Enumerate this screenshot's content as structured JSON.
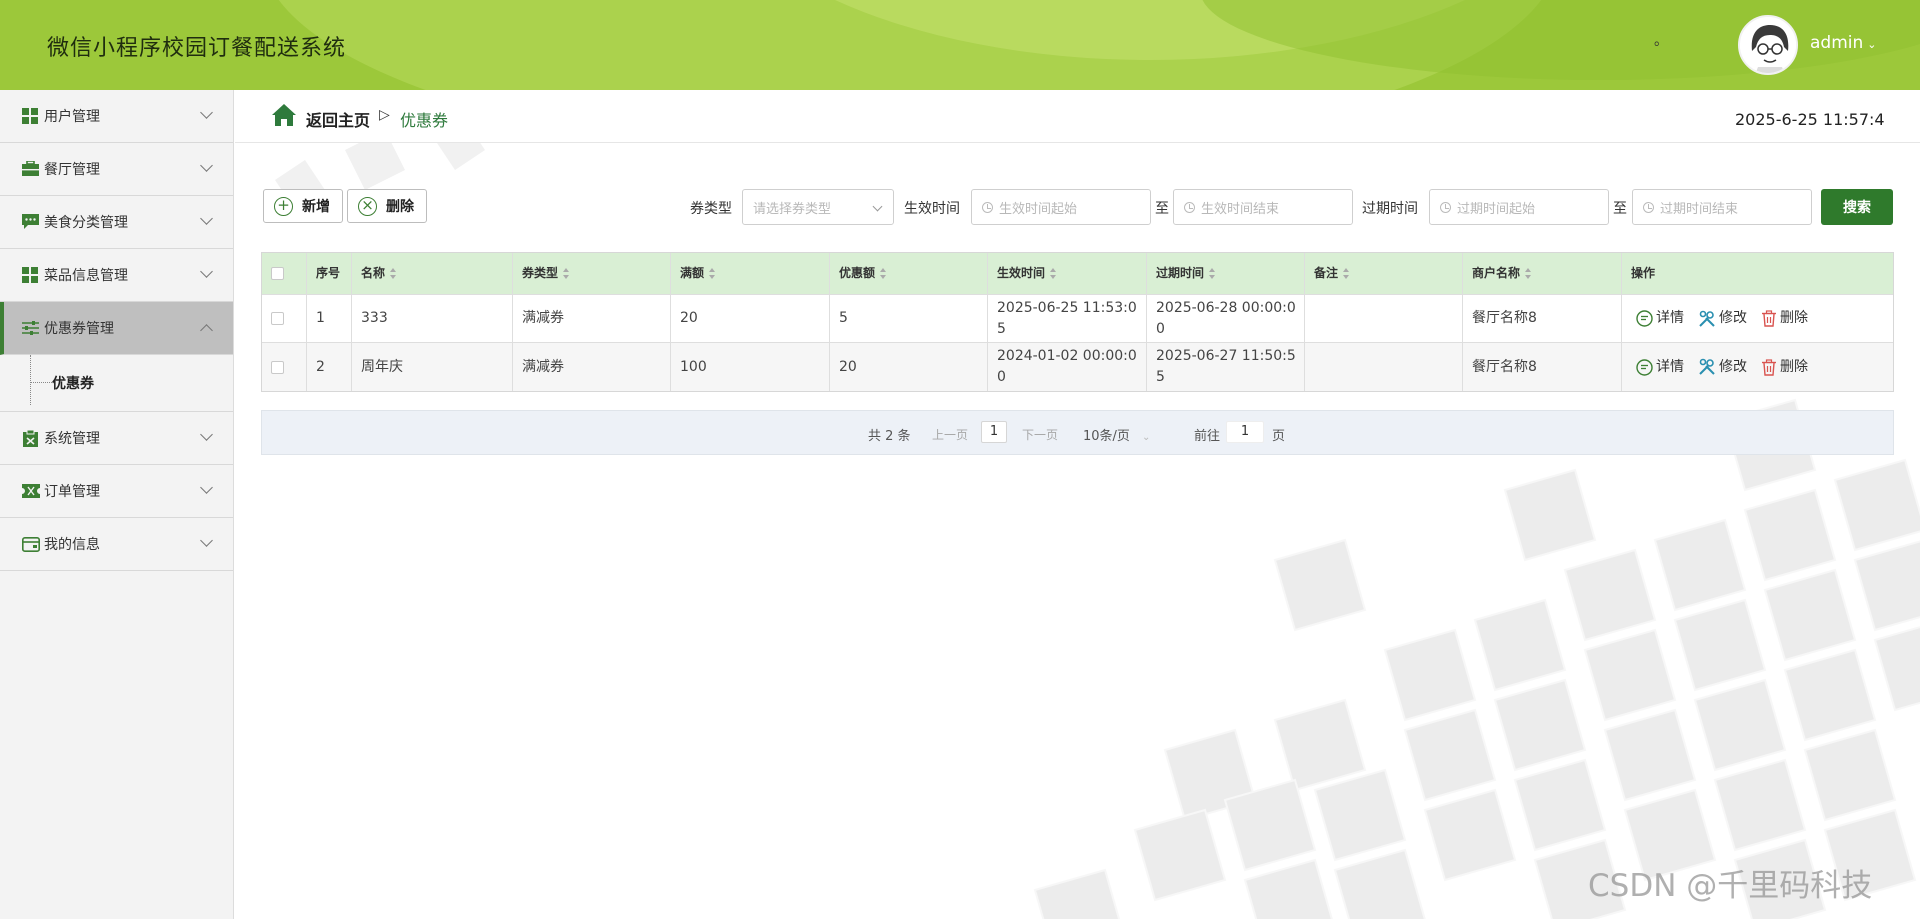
{
  "app": {
    "title": "微信小程序校园订餐配送系统",
    "dot": "。",
    "user": "admin",
    "user_chevron": "⌄"
  },
  "sidebar": {
    "items": [
      {
        "label": "用户管理",
        "icon": "grid-icon"
      },
      {
        "label": "餐厅管理",
        "icon": "briefcase-icon"
      },
      {
        "label": "美食分类管理",
        "icon": "chat-icon"
      },
      {
        "label": "菜品信息管理",
        "icon": "grid-icon"
      },
      {
        "label": "优惠券管理",
        "icon": "sliders-icon",
        "active": true
      },
      {
        "label": "系统管理",
        "icon": "clipboard-icon"
      },
      {
        "label": "订单管理",
        "icon": "ticket-icon"
      },
      {
        "label": "我的信息",
        "icon": "card-icon"
      }
    ],
    "submenu": {
      "label": "优惠券"
    }
  },
  "breadcrumb": {
    "home": "返回主页",
    "sep": "▷",
    "current": "优惠券"
  },
  "clock": "2025-6-25 11:57:4",
  "toolbar": {
    "add_label": "新增",
    "delete_label": "删除"
  },
  "filters": {
    "type_label": "券类型",
    "type_placeholder": "请选择券类型",
    "effective_label": "生效时间",
    "effective_start": "生效时间起始",
    "to1": "至",
    "effective_end": "生效时间结束",
    "expire_label": "过期时间",
    "expire_start": "过期时间起始",
    "to2": "至",
    "expire_end": "过期时间结束",
    "search_label": "搜索"
  },
  "table": {
    "headers": [
      "序号",
      "名称",
      "券类型",
      "满额",
      "优惠额",
      "生效时间",
      "过期时间",
      "备注",
      "商户名称",
      "操作"
    ],
    "rows": [
      {
        "no": "1",
        "name": "333",
        "type": "满减券",
        "full": "20",
        "discount": "5",
        "effective": "2025-06-25 11:53:05",
        "expire": "2025-06-28 00:00:00",
        "note": "",
        "merchant": "餐厅名称8"
      },
      {
        "no": "2",
        "name": "周年庆",
        "type": "满减券",
        "full": "100",
        "discount": "20",
        "effective": "2024-01-02 00:00:00",
        "expire": "2025-06-27 11:50:55",
        "note": "",
        "merchant": "餐厅名称8"
      }
    ],
    "ops": {
      "detail": "详情",
      "edit": "修改",
      "delete": "删除"
    }
  },
  "pager": {
    "total": "共 2 条",
    "prev": "上一页",
    "page": "1",
    "next": "下一页",
    "size": "10条/页",
    "goto": "前往",
    "goto_value": "1",
    "page_unit": "页"
  },
  "watermark": "CSDN @千里码科技",
  "colors": {
    "header": "#9cc83a",
    "accent": "#2f7a2c",
    "table_head": "#d9efd4"
  }
}
